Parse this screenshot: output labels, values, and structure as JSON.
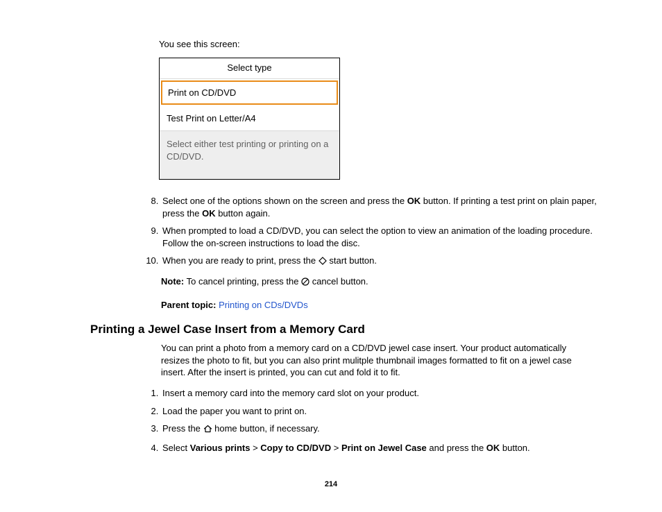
{
  "intro": "You see this screen:",
  "screen": {
    "title": "Select type",
    "option1": "Print on CD/DVD",
    "option2": "Test Print on Letter/A4",
    "help": "Select either test printing or printing on a CD/DVD."
  },
  "steps1": {
    "s8a": "Select one of the options shown on the screen and press the ",
    "s8b": " button. If printing a test print on plain paper, press the ",
    "s8c": " button again.",
    "s9": "When prompted to load a CD/DVD, you can select the option to view an animation of the loading procedure. Follow the on-screen instructions to load the disc.",
    "s10a": "When you are ready to print, press the ",
    "s10b": " start button."
  },
  "ok": "OK",
  "noteLabel": "Note:",
  "noteA": " To cancel printing, press the ",
  "noteB": " cancel button.",
  "parentLabel": "Parent topic:",
  "parentLink": "Printing on CDs/DVDs",
  "heading": "Printing a Jewel Case Insert from a Memory Card",
  "para": "You can print a photo from a memory card on a CD/DVD jewel case insert. Your product automatically resizes the photo to fit, but you can also print mulitple thumbnail images formatted to fit on a jewel case insert. After the insert is printed, you can cut and fold it to fit.",
  "steps2": {
    "s1": "Insert a memory card into the memory card slot on your product.",
    "s2": "Load the paper you want to print on.",
    "s3a": "Press the ",
    "s3b": " home button, if necessary.",
    "s4a": "Select ",
    "s4b": " > ",
    "s4c": " > ",
    "s4d": " and press the ",
    "s4e": " button."
  },
  "bold1": "Various prints",
  "bold2": "Copy to CD/DVD",
  "bold3": "Print on Jewel Case",
  "pageNum": "214"
}
